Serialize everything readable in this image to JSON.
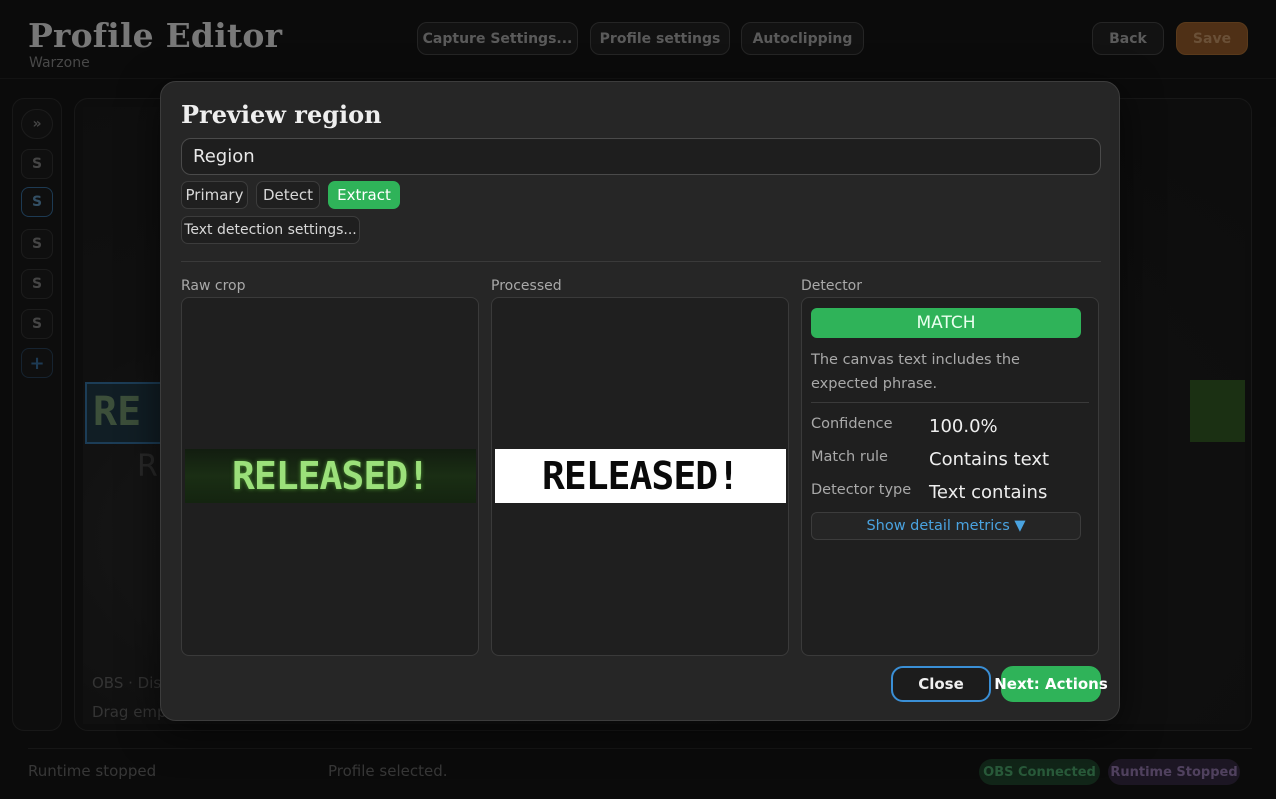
{
  "header": {
    "title": "Profile Editor",
    "subtitle": "Warzone",
    "capture_settings": "Capture Settings...",
    "profile_settings": "Profile settings",
    "autoclipping": "Autoclipping",
    "back": "Back",
    "save": "Save"
  },
  "rail": {
    "expand": "»",
    "items": [
      "S",
      "S",
      "S",
      "S",
      "S"
    ],
    "add": "+"
  },
  "canvas": {
    "selection_text": "RE",
    "sub_text": "R",
    "obs_label": "OBS · Disp",
    "drag_hint": "Drag emp"
  },
  "footer": {
    "runtime_status": "Runtime stopped",
    "profile_status": "Profile selected.",
    "obs_badge": "OBS Connected",
    "runtime_badge": "Runtime Stopped"
  },
  "modal": {
    "title": "Preview region",
    "region_value": "Region",
    "tabs": [
      {
        "label": "Primary",
        "active": false
      },
      {
        "label": "Detect",
        "active": false
      },
      {
        "label": "Extract",
        "active": true
      }
    ],
    "text_settings": "Text detection settings...",
    "columns": {
      "raw": "Raw crop",
      "processed": "Processed",
      "detector": "Detector"
    },
    "raw_text": "RELEASED!",
    "processed_text": "RELEASED!",
    "detector": {
      "result": "MATCH",
      "description": "The canvas text includes the expected phrase.",
      "rows": [
        {
          "key": "Confidence",
          "value": "100.0%"
        },
        {
          "key": "Match rule",
          "value": "Contains text"
        },
        {
          "key": "Detector type",
          "value": "Text contains"
        }
      ],
      "show_metrics": "Show detail metrics ▼"
    },
    "close": "Close",
    "next": "Next: Actions"
  },
  "colors": {
    "accent_green": "#2fb359",
    "accent_blue": "#3a8fd6",
    "save_orange": "#7a4a22"
  }
}
